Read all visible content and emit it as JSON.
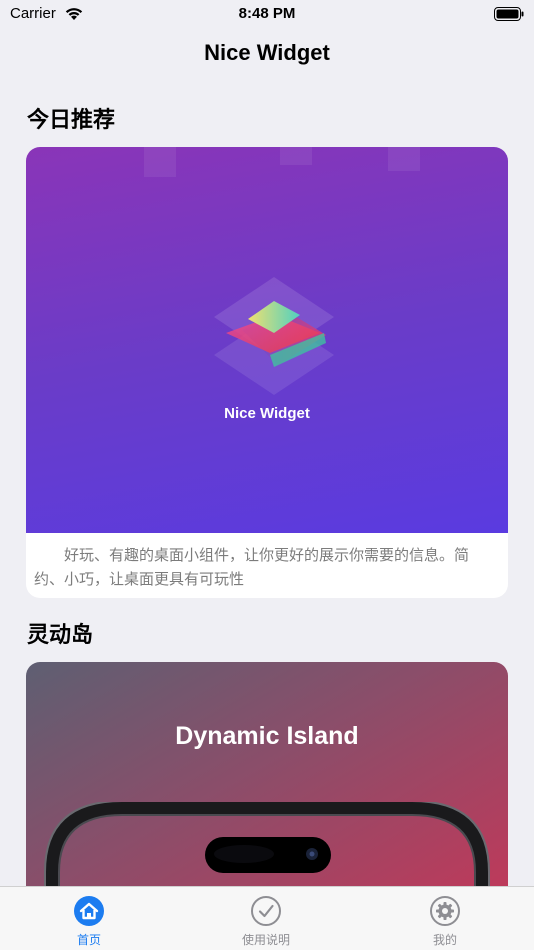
{
  "status_bar": {
    "carrier": "Carrier",
    "time": "8:48 PM"
  },
  "nav": {
    "title": "Nice Widget"
  },
  "sections": {
    "recommend": {
      "title": "今日推荐",
      "card_logo_label": "Nice Widget",
      "description": "好玩、有趣的桌面小组件，让你更好的展示你需要的信息。简约、小巧，让桌面更具有可玩性"
    },
    "dynamic_island": {
      "title": "灵动岛",
      "card_title": "Dynamic Island"
    }
  },
  "tab_bar": {
    "items": [
      {
        "label": "首页",
        "icon": "home-icon",
        "active": true
      },
      {
        "label": "使用说明",
        "icon": "checkmark-circle-icon",
        "active": false
      },
      {
        "label": "我的",
        "icon": "gear-icon",
        "active": false
      }
    ]
  },
  "colors": {
    "accent": "#1c7cf0",
    "inactive": "#8e8e93",
    "background": "#efeff4"
  }
}
